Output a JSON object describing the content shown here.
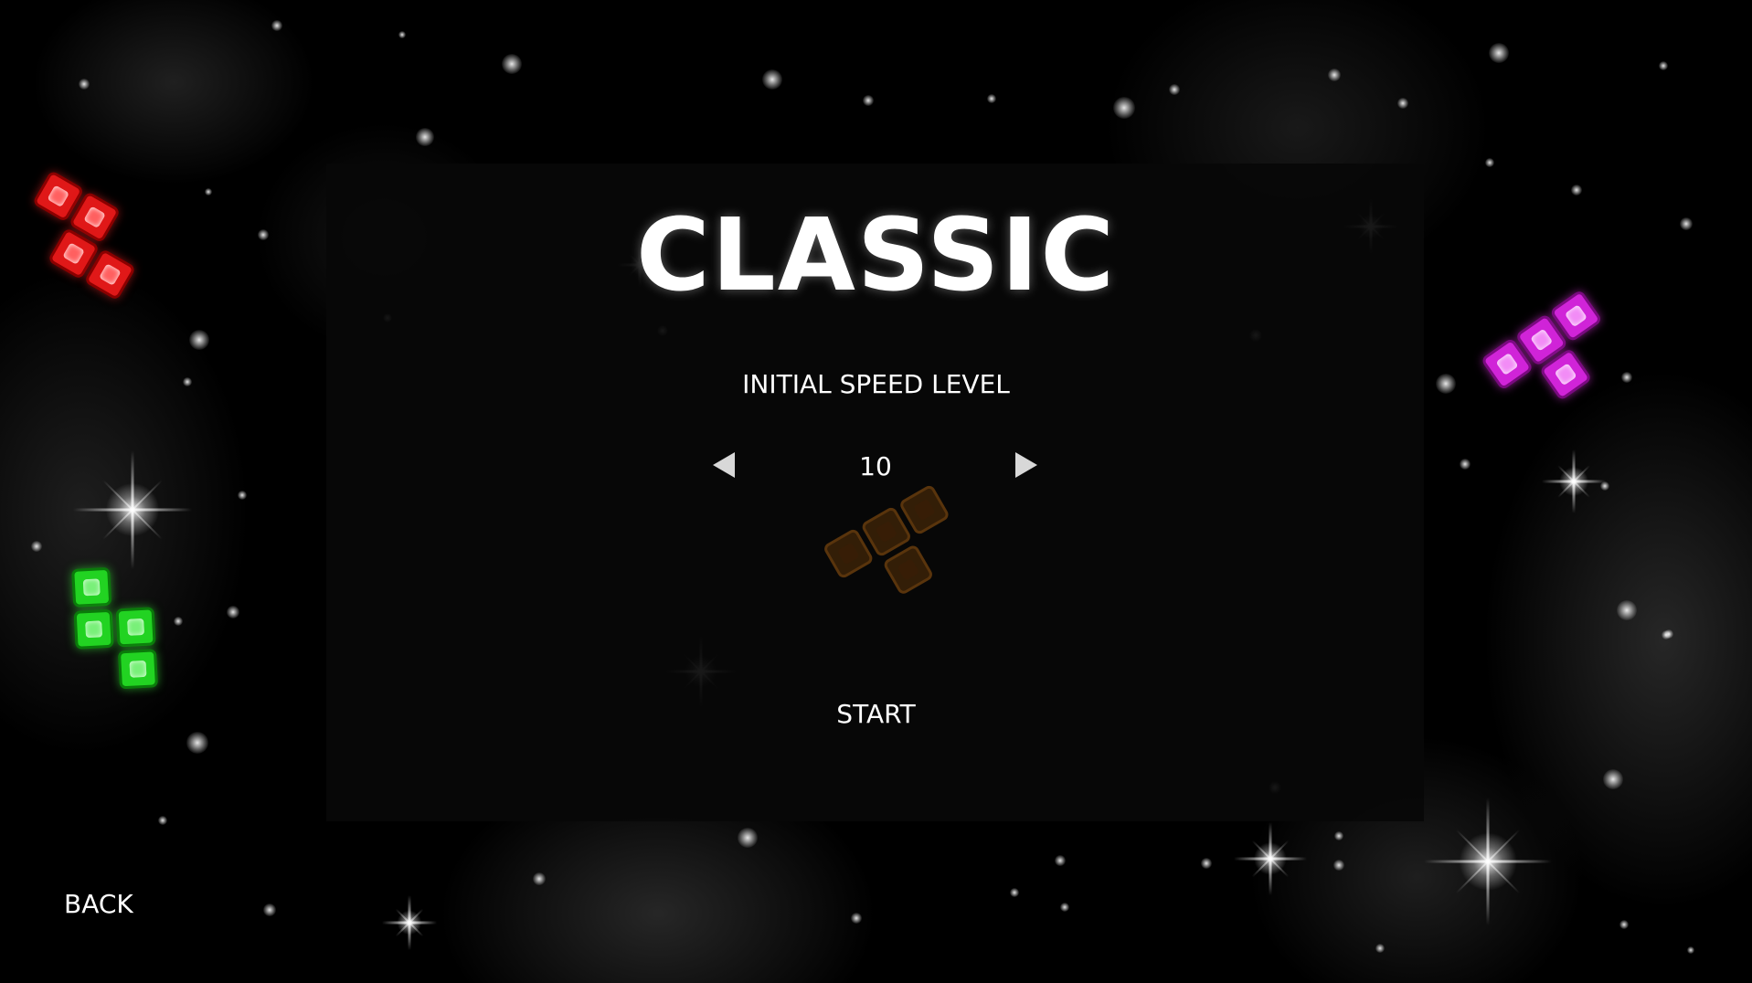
{
  "screen": {
    "title": "CLASSIC",
    "speed_setting": {
      "label": "INITIAL SPEED LEVEL",
      "value": "10",
      "decrease_icon": "triangle-left-icon",
      "increase_icon": "triangle-right-icon"
    },
    "start_label": "START",
    "back_label": "BACK"
  },
  "decor_pieces": [
    {
      "name": "red-tetromino",
      "color": "#e01818"
    },
    {
      "name": "green-tetromino",
      "color": "#22d322"
    },
    {
      "name": "magenta-tetromino",
      "color": "#d024d8"
    },
    {
      "name": "orange-tetromino",
      "color": "#8a4a10"
    }
  ],
  "theme": {
    "background": "#000000",
    "panel": "#080808",
    "text": "#ffffff"
  }
}
